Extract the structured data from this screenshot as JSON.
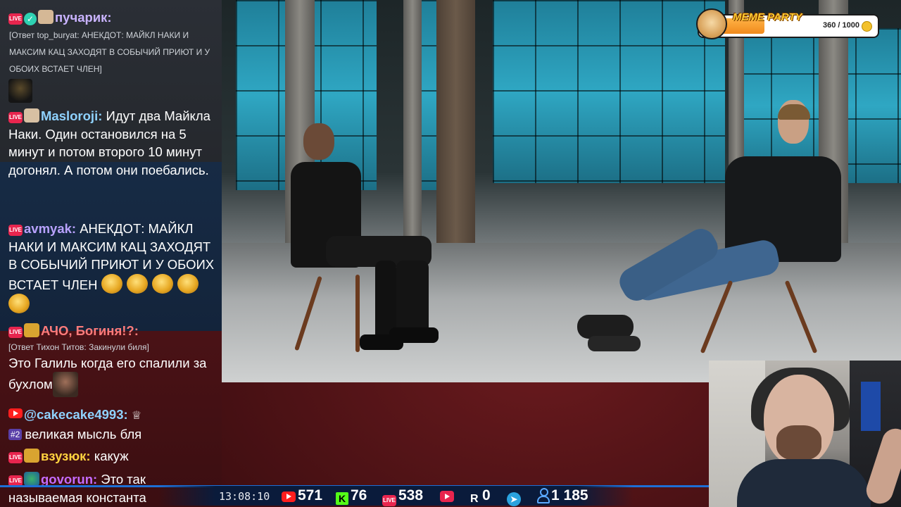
{
  "overlay": {
    "meme_title": "MEME PARTY",
    "meme_value": "360 / 1000",
    "meme_progress": 0.36
  },
  "chat": {
    "messages": [
      {
        "nick": "пучарик:",
        "nick_color": "#c9b3ff",
        "reply": "[Ответ top_buryat: АНЕКДОТ: МАЙКЛ НАКИ И МАКСИМ КАЦ ЗАХОДЯТ В СОБЫЧИЙ ПРИЮТ И У ОБОИХ ВСТАЕТ ЧЛЕН]"
      },
      {
        "nick": "Masloroji:",
        "nick_color": "#8fd2ff",
        "text": "Идут два Майкла Наки. Один остановился на 5 минут и потом второго 10 минут догонял. А потом они поебались."
      },
      {
        "nick": "avmyak:",
        "nick_color": "#b9a2ff",
        "text": "АНЕКДОТ: МАЙКЛ НАКИ И МАКСИМ КАЦ ЗАХОДЯТ В СОБЫЧИЙ ПРИЮТ И У ОБОИХ ВСТАЕТ ЧЛЕН"
      },
      {
        "nick": "АЧО, Богиня!?:",
        "nick_color": "#ff7b7b",
        "reply": "[Ответ Тихон Титов: Закинули биля]",
        "text": "Это Галиль когда его спалили за бухлом"
      },
      {
        "nick": "@cakecake4993:",
        "nick_color": "#8fd2ff",
        "badge": "#2",
        "text": "великая мысль бля"
      },
      {
        "nick": "взузюк:",
        "nick_color": "#ffd23f",
        "text": "какуж"
      },
      {
        "nick": "govorun:",
        "nick_color": "#c66bff",
        "text": "Это так называемая константа"
      }
    ]
  },
  "stats": {
    "clock": "13:08:10",
    "youtube": "571",
    "kick": "76",
    "live": "538",
    "rutube": "0",
    "viewers": "1 185"
  },
  "colors": {
    "live_badge": "#e8254e",
    "youtube": "#ff1e1e",
    "kick": "#53fc18",
    "telegram": "#2aa3df",
    "bar": "#0a1b3b",
    "bar_line": "#1d6fd6"
  }
}
